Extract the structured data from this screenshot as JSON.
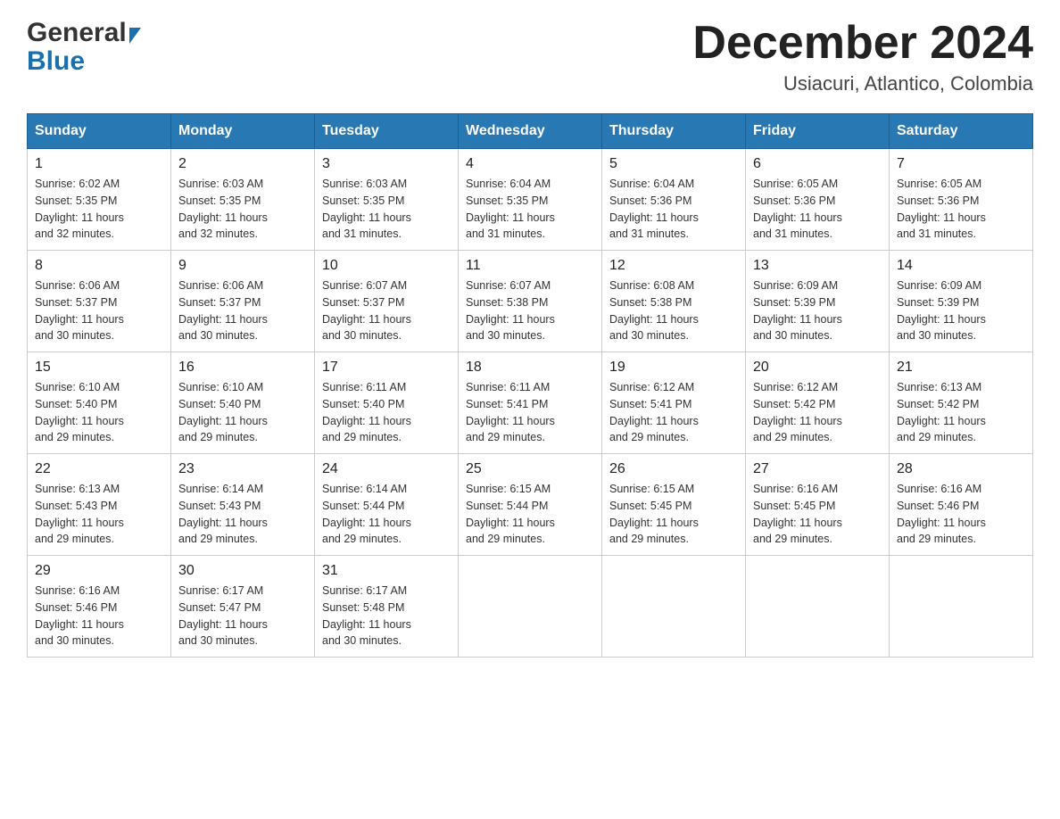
{
  "header": {
    "logo_general": "General",
    "logo_blue": "Blue",
    "month_title": "December 2024",
    "location": "Usiacuri, Atlantico, Colombia"
  },
  "weekdays": [
    "Sunday",
    "Monday",
    "Tuesday",
    "Wednesday",
    "Thursday",
    "Friday",
    "Saturday"
  ],
  "weeks": [
    [
      {
        "day": "1",
        "sunrise": "6:02 AM",
        "sunset": "5:35 PM",
        "daylight": "11 hours and 32 minutes."
      },
      {
        "day": "2",
        "sunrise": "6:03 AM",
        "sunset": "5:35 PM",
        "daylight": "11 hours and 32 minutes."
      },
      {
        "day": "3",
        "sunrise": "6:03 AM",
        "sunset": "5:35 PM",
        "daylight": "11 hours and 31 minutes."
      },
      {
        "day": "4",
        "sunrise": "6:04 AM",
        "sunset": "5:35 PM",
        "daylight": "11 hours and 31 minutes."
      },
      {
        "day": "5",
        "sunrise": "6:04 AM",
        "sunset": "5:36 PM",
        "daylight": "11 hours and 31 minutes."
      },
      {
        "day": "6",
        "sunrise": "6:05 AM",
        "sunset": "5:36 PM",
        "daylight": "11 hours and 31 minutes."
      },
      {
        "day": "7",
        "sunrise": "6:05 AM",
        "sunset": "5:36 PM",
        "daylight": "11 hours and 31 minutes."
      }
    ],
    [
      {
        "day": "8",
        "sunrise": "6:06 AM",
        "sunset": "5:37 PM",
        "daylight": "11 hours and 30 minutes."
      },
      {
        "day": "9",
        "sunrise": "6:06 AM",
        "sunset": "5:37 PM",
        "daylight": "11 hours and 30 minutes."
      },
      {
        "day": "10",
        "sunrise": "6:07 AM",
        "sunset": "5:37 PM",
        "daylight": "11 hours and 30 minutes."
      },
      {
        "day": "11",
        "sunrise": "6:07 AM",
        "sunset": "5:38 PM",
        "daylight": "11 hours and 30 minutes."
      },
      {
        "day": "12",
        "sunrise": "6:08 AM",
        "sunset": "5:38 PM",
        "daylight": "11 hours and 30 minutes."
      },
      {
        "day": "13",
        "sunrise": "6:09 AM",
        "sunset": "5:39 PM",
        "daylight": "11 hours and 30 minutes."
      },
      {
        "day": "14",
        "sunrise": "6:09 AM",
        "sunset": "5:39 PM",
        "daylight": "11 hours and 30 minutes."
      }
    ],
    [
      {
        "day": "15",
        "sunrise": "6:10 AM",
        "sunset": "5:40 PM",
        "daylight": "11 hours and 29 minutes."
      },
      {
        "day": "16",
        "sunrise": "6:10 AM",
        "sunset": "5:40 PM",
        "daylight": "11 hours and 29 minutes."
      },
      {
        "day": "17",
        "sunrise": "6:11 AM",
        "sunset": "5:40 PM",
        "daylight": "11 hours and 29 minutes."
      },
      {
        "day": "18",
        "sunrise": "6:11 AM",
        "sunset": "5:41 PM",
        "daylight": "11 hours and 29 minutes."
      },
      {
        "day": "19",
        "sunrise": "6:12 AM",
        "sunset": "5:41 PM",
        "daylight": "11 hours and 29 minutes."
      },
      {
        "day": "20",
        "sunrise": "6:12 AM",
        "sunset": "5:42 PM",
        "daylight": "11 hours and 29 minutes."
      },
      {
        "day": "21",
        "sunrise": "6:13 AM",
        "sunset": "5:42 PM",
        "daylight": "11 hours and 29 minutes."
      }
    ],
    [
      {
        "day": "22",
        "sunrise": "6:13 AM",
        "sunset": "5:43 PM",
        "daylight": "11 hours and 29 minutes."
      },
      {
        "day": "23",
        "sunrise": "6:14 AM",
        "sunset": "5:43 PM",
        "daylight": "11 hours and 29 minutes."
      },
      {
        "day": "24",
        "sunrise": "6:14 AM",
        "sunset": "5:44 PM",
        "daylight": "11 hours and 29 minutes."
      },
      {
        "day": "25",
        "sunrise": "6:15 AM",
        "sunset": "5:44 PM",
        "daylight": "11 hours and 29 minutes."
      },
      {
        "day": "26",
        "sunrise": "6:15 AM",
        "sunset": "5:45 PM",
        "daylight": "11 hours and 29 minutes."
      },
      {
        "day": "27",
        "sunrise": "6:16 AM",
        "sunset": "5:45 PM",
        "daylight": "11 hours and 29 minutes."
      },
      {
        "day": "28",
        "sunrise": "6:16 AM",
        "sunset": "5:46 PM",
        "daylight": "11 hours and 29 minutes."
      }
    ],
    [
      {
        "day": "29",
        "sunrise": "6:16 AM",
        "sunset": "5:46 PM",
        "daylight": "11 hours and 30 minutes."
      },
      {
        "day": "30",
        "sunrise": "6:17 AM",
        "sunset": "5:47 PM",
        "daylight": "11 hours and 30 minutes."
      },
      {
        "day": "31",
        "sunrise": "6:17 AM",
        "sunset": "5:48 PM",
        "daylight": "11 hours and 30 minutes."
      },
      null,
      null,
      null,
      null
    ]
  ],
  "labels": {
    "sunrise": "Sunrise:",
    "sunset": "Sunset:",
    "daylight": "Daylight:"
  }
}
